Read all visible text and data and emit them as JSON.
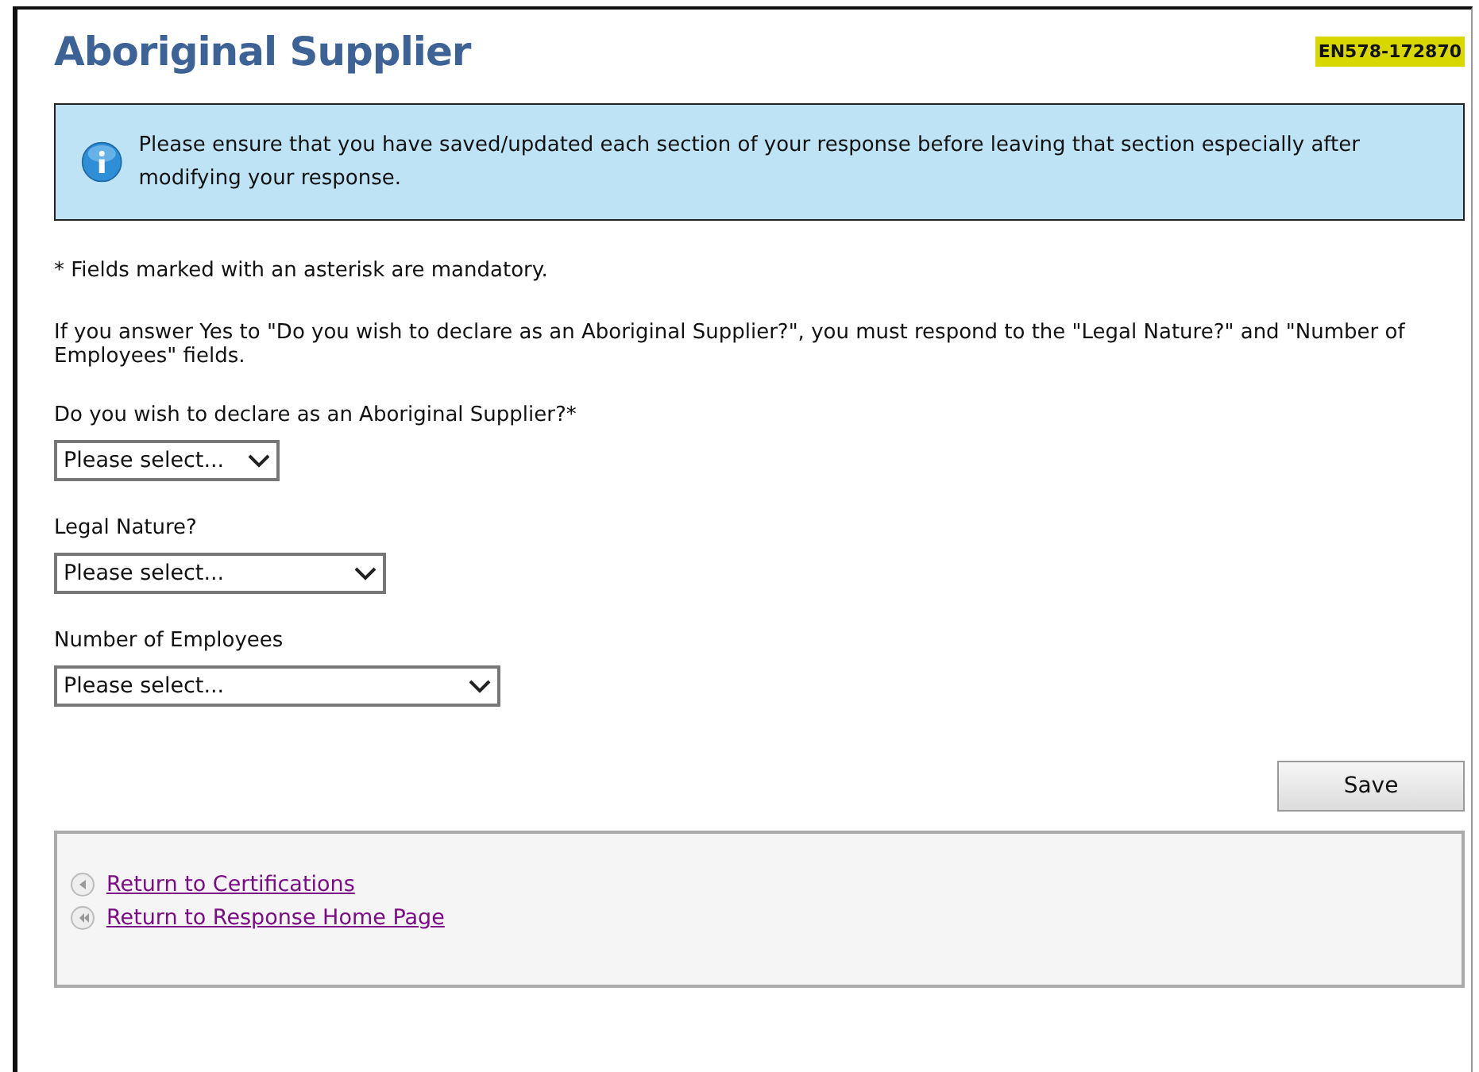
{
  "title": "Aboriginal Supplier",
  "reference": "EN578-172870",
  "notice": "Please ensure that you have saved/updated each section of your response before leaving that section especially after modifying your response.",
  "mandatory_note": "* Fields marked with an asterisk are mandatory.",
  "instructions": "If you answer Yes to \"Do you wish to declare as an Aboriginal Supplier?\", you must respond to the  \"Legal Nature?\" and \"Number of Employees\" fields.",
  "fields": [
    {
      "label": "Do you wish to declare as an Aboriginal Supplier?*",
      "value": "Please select..."
    },
    {
      "label": "Legal Nature?",
      "value": "Please select..."
    },
    {
      "label": "Number of Employees",
      "value": "Please select..."
    }
  ],
  "save_button": "Save",
  "links": [
    {
      "label": "Return to Certifications",
      "kind": "single"
    },
    {
      "label": "Return to Response Home Page",
      "kind": "double"
    }
  ]
}
